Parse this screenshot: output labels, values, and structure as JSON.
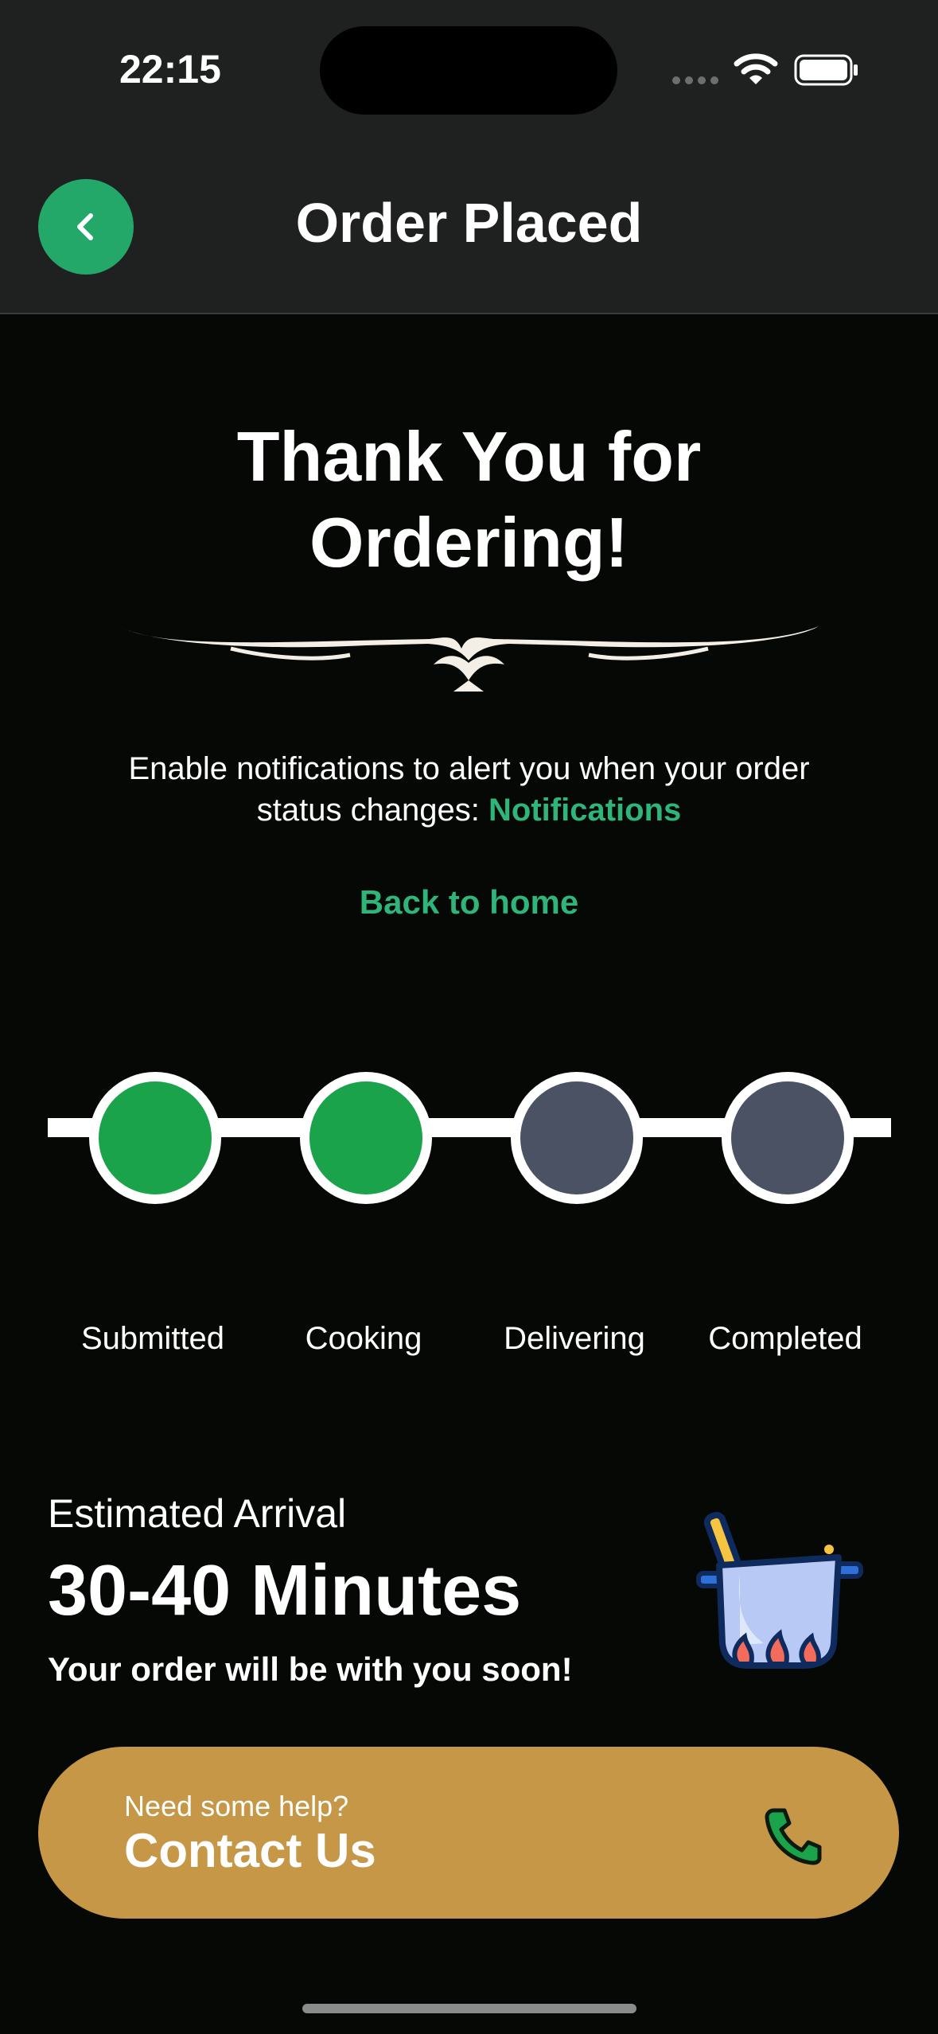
{
  "status_bar": {
    "time": "22:15"
  },
  "header": {
    "title": "Order Placed",
    "back_icon": "chevron-left-icon"
  },
  "main": {
    "title_line1": "Thank You for",
    "title_line2": "Ordering!",
    "notify_text": "Enable notifications to alert you when your order status changes: ",
    "notify_link": "Notifications",
    "back_home": "Back to home"
  },
  "progress": {
    "steps": [
      {
        "label": "Submitted",
        "done": true
      },
      {
        "label": "Cooking",
        "done": true
      },
      {
        "label": "Delivering",
        "done": false
      },
      {
        "label": "Completed",
        "done": false
      }
    ],
    "colors": {
      "done": "#1aa34a",
      "pending": "#4a5263"
    }
  },
  "eta": {
    "label": "Estimated Arrival",
    "value": "30-40 Minutes",
    "subtitle": "Your order will be with you soon!",
    "icon": "cooking-pot-icon"
  },
  "contact": {
    "small": "Need some help?",
    "big": "Contact Us",
    "icon": "phone-icon"
  },
  "colors": {
    "accent": "#2fb57a",
    "contact_bg": "#c59746",
    "header_bg": "#1e211f"
  }
}
